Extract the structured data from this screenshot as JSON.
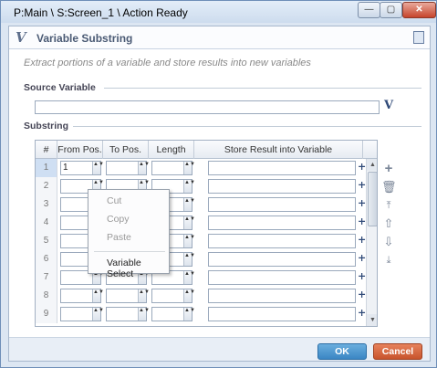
{
  "window": {
    "title": "P:Main \\ S:Screen_1 \\ Action Ready",
    "min_glyph": "—",
    "max_glyph": "▢",
    "close_glyph": "✕"
  },
  "dialog": {
    "title": "Variable Substring",
    "description": "Extract portions of  a variable and store results into new variables",
    "logo_letter": "V"
  },
  "source": {
    "label": "Source Variable",
    "value": "",
    "vbutton": "V"
  },
  "substring": {
    "label": "Substring",
    "columns": [
      "#",
      "From Pos.",
      "To Pos.",
      "Length",
      "Store Result into Variable"
    ],
    "rows": [
      {
        "num": "1",
        "from": "1",
        "to": "",
        "length": "",
        "store": ""
      },
      {
        "num": "2",
        "from": "",
        "to": "",
        "length": "",
        "store": ""
      },
      {
        "num": "3",
        "from": "",
        "to": "",
        "length": "",
        "store": ""
      },
      {
        "num": "4",
        "from": "",
        "to": "",
        "length": "",
        "store": ""
      },
      {
        "num": "5",
        "from": "",
        "to": "",
        "length": "",
        "store": ""
      },
      {
        "num": "6",
        "from": "",
        "to": "",
        "length": "",
        "store": ""
      },
      {
        "num": "7",
        "from": "",
        "to": "",
        "length": "",
        "store": ""
      },
      {
        "num": "8",
        "from": "",
        "to": "",
        "length": "",
        "store": ""
      },
      {
        "num": "9",
        "from": "",
        "to": "",
        "length": "",
        "store": ""
      }
    ],
    "row_vbutton": "+V"
  },
  "context_menu": {
    "items": [
      "Cut",
      "Copy",
      "Paste",
      "Variable Select"
    ]
  },
  "side_tools": [
    "add-icon",
    "delete-icon",
    "move-top-icon",
    "move-up-icon",
    "move-down-icon",
    "move-bottom-icon"
  ],
  "footer": {
    "ok_label": "OK",
    "cancel_label": "Cancel"
  },
  "colors": {
    "ok": "#3b86c4",
    "cancel": "#c8542c",
    "accent": "#2f4a78"
  }
}
